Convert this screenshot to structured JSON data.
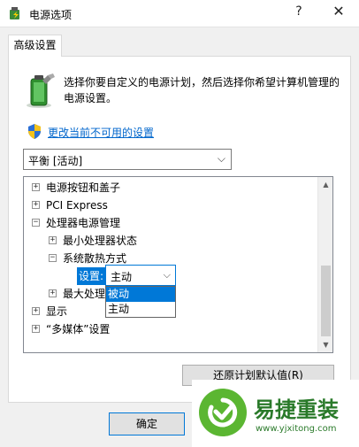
{
  "window": {
    "title": "电源选项",
    "help": "?",
    "close": "✕"
  },
  "tab": {
    "label": "高级设置"
  },
  "description": "选择你要自定义的电源计划，然后选择你希望计算机管理的电源设置。",
  "change_link": "更改当前不可用的设置",
  "plan_select": {
    "value": "平衡 [活动]"
  },
  "tree": {
    "items": [
      {
        "label": "电源按钮和盖子",
        "expander": "+"
      },
      {
        "label": "PCI Express",
        "expander": "+"
      },
      {
        "label": "处理器电源管理",
        "expander": "−"
      },
      {
        "label": "最小处理器状态",
        "expander": "+"
      },
      {
        "label": "系统散热方式",
        "expander": "−"
      },
      {
        "label": "最大处理",
        "expander": "+"
      },
      {
        "label": "显示",
        "expander": "+"
      },
      {
        "label": "“多媒体”设置",
        "expander": "+"
      }
    ],
    "setting_label": "设置:",
    "setting_value": "主动",
    "options": [
      "被动",
      "主动"
    ]
  },
  "buttons": {
    "restore": "还原计划默认值(R)",
    "ok": "确定"
  },
  "watermark": {
    "main": "易捷重装",
    "url": "www.yjxitong.com"
  },
  "colors": {
    "accent": "#0078d7",
    "link": "#0066cc",
    "watermark_green": "#5bb632"
  }
}
